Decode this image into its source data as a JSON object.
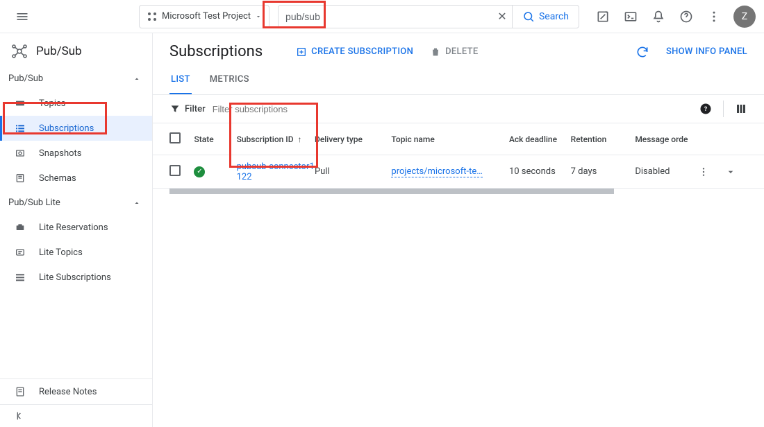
{
  "topbar": {
    "project_name": "Microsoft Test Project",
    "search_value": "pub/sub",
    "search_btn": "Search",
    "avatar_initial": "Z"
  },
  "sidebar": {
    "product": "Pub/Sub",
    "section1": {
      "label": "Pub/Sub"
    },
    "items1": [
      {
        "label": "Topics"
      },
      {
        "label": "Subscriptions"
      },
      {
        "label": "Snapshots"
      },
      {
        "label": "Schemas"
      }
    ],
    "section2": {
      "label": "Pub/Sub Lite"
    },
    "items2": [
      {
        "label": "Lite Reservations"
      },
      {
        "label": "Lite Topics"
      },
      {
        "label": "Lite Subscriptions"
      }
    ],
    "release_notes": "Release Notes"
  },
  "page": {
    "title": "Subscriptions",
    "create_label": "CREATE SUBSCRIPTION",
    "delete_label": "DELETE",
    "info_panel": "SHOW INFO PANEL"
  },
  "tabs": {
    "list": "LIST",
    "metrics": "METRICS"
  },
  "filter": {
    "label": "Filter",
    "placeholder": "Filter subscriptions"
  },
  "table": {
    "headers": {
      "state": "State",
      "sub_id": "Subscription ID",
      "delivery": "Delivery type",
      "topic": "Topic name",
      "ack": "Ack deadline",
      "retention": "Retention",
      "order": "Message orde"
    },
    "rows": [
      {
        "sub_id": "pubsub-connector1122",
        "delivery": "Pull",
        "topic": "projects/microsoft-te…",
        "ack": "10 seconds",
        "retention": "7 days",
        "order": "Disabled"
      }
    ]
  }
}
